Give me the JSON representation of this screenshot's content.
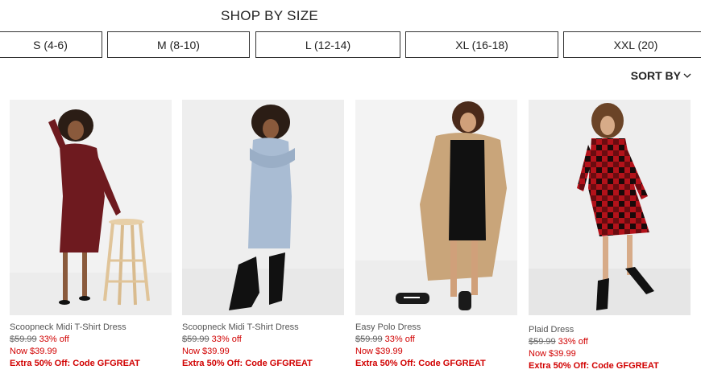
{
  "section_title": "SHOP BY SIZE",
  "sizes": [
    "S (4-6)",
    "M (8-10)",
    "L (12-14)",
    "XL (16-18)",
    "XXL (20)"
  ],
  "sort_label": "SORT BY",
  "sort_icon": "chevron-down-icon",
  "products": [
    {
      "name": "Scoopneck Midi T-Shirt Dress",
      "was": "$59.99",
      "off": "33% off",
      "now": "Now $39.99",
      "promo": "Extra 50% Off: Code GFGREAT",
      "dress_color": "#6e1a1f"
    },
    {
      "name": "Scoopneck Midi T-Shirt Dress",
      "was": "$59.99",
      "off": "33% off",
      "now": "Now $39.99",
      "promo": "Extra 50% Off: Code GFGREAT",
      "dress_color": "#a9bcd3"
    },
    {
      "name": "Easy Polo Dress",
      "was": "$59.99",
      "off": "33% off",
      "now": "Now $39.99",
      "promo": "Extra 50% Off: Code GFGREAT",
      "dress_color": "#111111"
    },
    {
      "name": "Plaid Dress",
      "was": "$59.99",
      "off": "33% off",
      "now": "Now $39.99",
      "promo": "Extra 50% Off: Code GFGREAT",
      "dress_color": "#b3121a"
    }
  ]
}
